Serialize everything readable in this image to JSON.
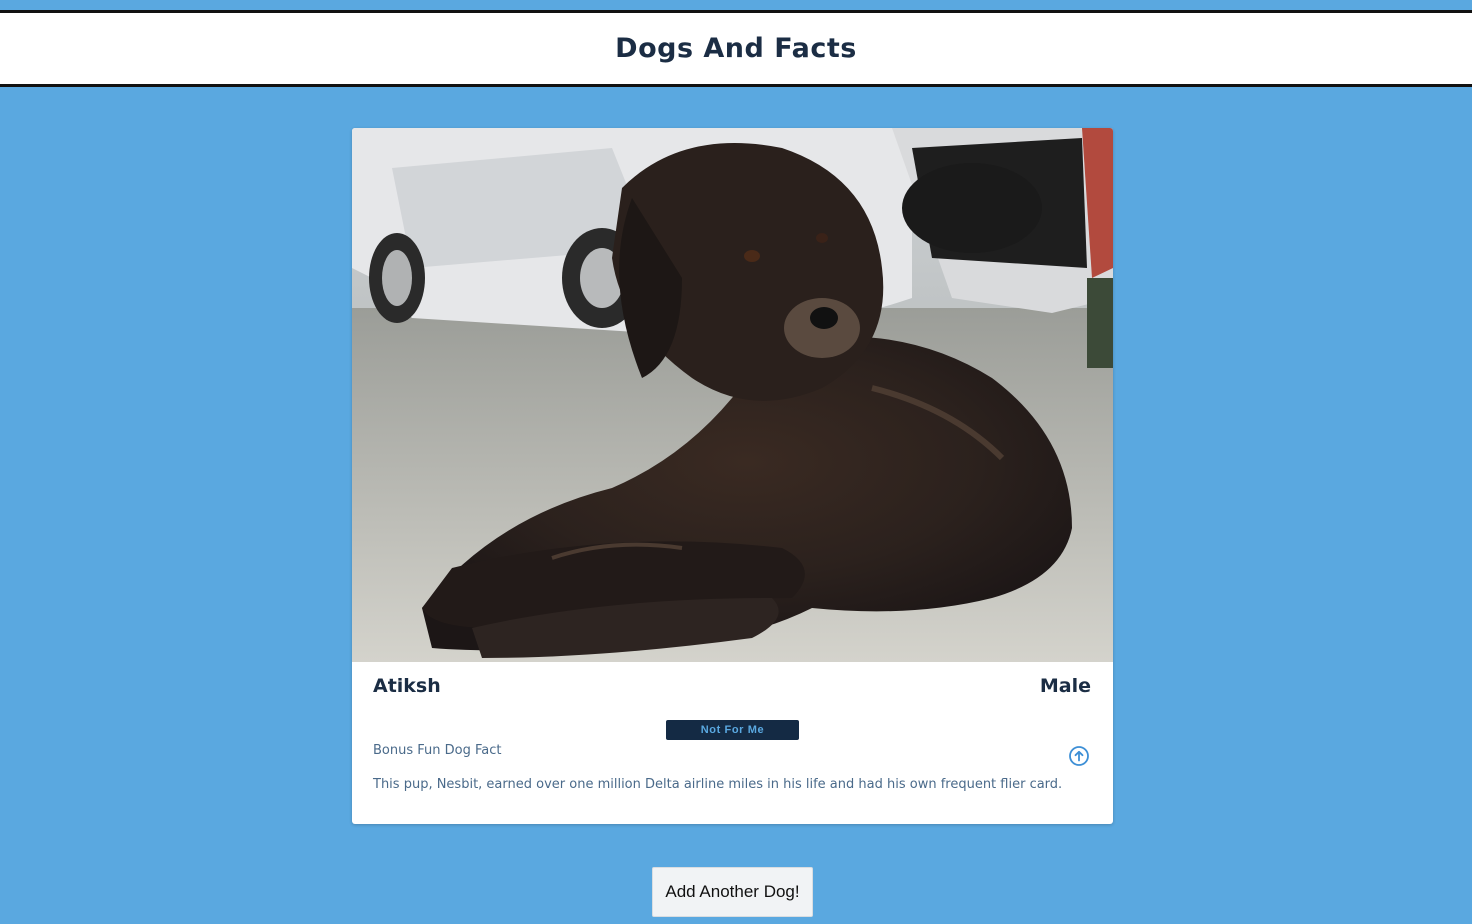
{
  "header": {
    "title": "Dogs And Facts"
  },
  "card": {
    "photo_alt": "Fluffy dark brown dog lying on gravel in front of a white car",
    "name": "Atiksh",
    "gender": "Male",
    "reject_label": "Not For Me",
    "fact_label": "Bonus Fun Dog Fact",
    "fact_text": "This pup, Nesbit, earned over one million Delta airline miles in his life and had his own frequent flier card.",
    "expand_icon": "arrow-up-circle-icon"
  },
  "actions": {
    "add_label": "Add Another Dog!"
  },
  "colors": {
    "background": "#5aa8e0",
    "header_bg": "#ffffff",
    "title_text": "#1b2d44",
    "button_dark": "#142a44",
    "accent": "#5aa8e0",
    "muted_text": "#4a6a8a"
  }
}
